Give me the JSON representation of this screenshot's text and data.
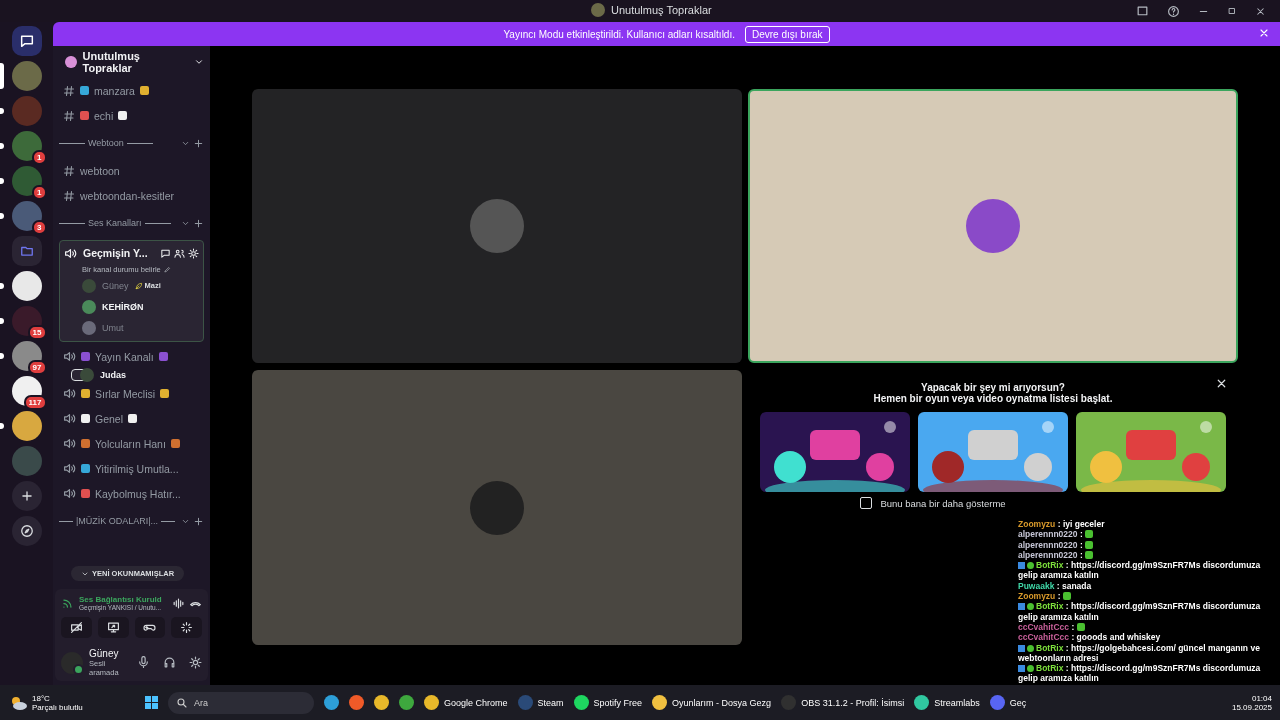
{
  "window": {
    "title": "Unutulmuş Topraklar"
  },
  "banner": {
    "text": "Yayıncı Modu etkinleştirildi. Kullanıcı adları kısaltıldı.",
    "button": "Devre dışı bırak"
  },
  "servers": [
    {
      "kind": "home"
    },
    {
      "kind": "server",
      "selected": true,
      "unread": false,
      "color": "#6b6a48"
    },
    {
      "kind": "server",
      "selected": false,
      "unread": true,
      "color": "#5a2a22"
    },
    {
      "kind": "server",
      "selected": false,
      "unread": true,
      "color": "#3d6a3a",
      "badge": "1"
    },
    {
      "kind": "server",
      "selected": false,
      "unread": true,
      "color": "#2f5a34",
      "badge": "1"
    },
    {
      "kind": "server",
      "selected": false,
      "unread": true,
      "color": "#4a5a78",
      "badge": "3"
    },
    {
      "kind": "folder"
    },
    {
      "kind": "server",
      "selected": false,
      "unread": true,
      "color": "#e8e8e8"
    },
    {
      "kind": "server",
      "selected": false,
      "unread": true,
      "color": "#3a1a2a",
      "badge": "15"
    },
    {
      "kind": "server",
      "selected": false,
      "unread": true,
      "color": "#8a8a8a",
      "badge": "97"
    },
    {
      "kind": "server",
      "selected": false,
      "unread": false,
      "color": "#f0f0f0",
      "badge": "117"
    },
    {
      "kind": "server",
      "selected": false,
      "unread": true,
      "color": "#d8a840"
    },
    {
      "kind": "server",
      "selected": false,
      "unread": false,
      "color": "#3a4a4a"
    },
    {
      "kind": "add"
    },
    {
      "kind": "discover"
    }
  ],
  "channel_header": "Unutulmuş Topraklar",
  "channels": [
    {
      "kind": "text",
      "name": "manzara",
      "emoji_before": true,
      "emoji_after": true
    },
    {
      "kind": "text",
      "name": "echi",
      "emoji_before": true,
      "emoji_after": true
    },
    {
      "kind": "category",
      "name": "Webtoon"
    },
    {
      "kind": "text",
      "name": "webtoon",
      "emoji_before": false,
      "emoji_after": false
    },
    {
      "kind": "text",
      "name": "webtoondan-kesitler",
      "emoji_before": false,
      "emoji_after": false
    },
    {
      "kind": "category",
      "name": "Ses Kanalları"
    },
    {
      "kind": "voice",
      "name": "Geçmişin Y...",
      "selected": true,
      "status": "Bir kanal durumu belirle",
      "members": [
        {
          "name": "Güney",
          "dimmed": true,
          "tag": "Mazi"
        },
        {
          "name": "KEHİRØN",
          "dimmed": false
        },
        {
          "name": "Umut",
          "dimmed": true
        }
      ]
    },
    {
      "kind": "voice",
      "name": "Yayın Kanalı",
      "selected": false,
      "emoji_before": true,
      "emoji_after": true,
      "members": [
        {
          "name": "Judas",
          "dimmed": false
        }
      ]
    },
    {
      "kind": "voice",
      "name": "Sırlar Meclisi",
      "selected": false,
      "emoji_before": true,
      "emoji_after": true
    },
    {
      "kind": "voice",
      "name": "Genel",
      "selected": false,
      "emoji_before": true,
      "emoji_after": true
    },
    {
      "kind": "voice",
      "name": "Yolcuların Hanı",
      "selected": false,
      "emoji_before": true,
      "emoji_after": true
    },
    {
      "kind": "voice",
      "name": "Yitirilmiş Umutla...",
      "selected": false,
      "emoji_before": true,
      "emoji_after": false
    },
    {
      "kind": "voice",
      "name": "Kaybolmuş Hatır...",
      "selected": false,
      "emoji_before": true,
      "emoji_after": false
    },
    {
      "kind": "category",
      "name": "|MÜZİK ODALARI|..."
    }
  ],
  "unread_pill": "YENİ OKUNMAMIŞLAR",
  "voice_panel": {
    "title": "Ses Bağlantısı Kuruld",
    "subtitle": "Geçmişin YANKISI / Unutu..."
  },
  "user": {
    "name": "Güney",
    "status": "Sesli aramada"
  },
  "tiles": [
    {
      "kind": "video",
      "speaking": false,
      "color": "#232325"
    },
    {
      "kind": "video",
      "speaking": true,
      "color": "#d6cab6"
    },
    {
      "kind": "video",
      "speaking": false,
      "color": "#4a4741"
    },
    {
      "kind": "activity",
      "title": "Yapacak bir şey mi arıyorsun?",
      "subtitle": "Hemen bir oyun veya video oynatma listesi başlat.",
      "checkbox": {
        "label": "Bunu bana bir daha gösterme",
        "checked": false
      }
    }
  ],
  "chat": [
    {
      "user": "Zoomyzu",
      "color": "#d99a2b",
      "bot": false,
      "kind": "text",
      "text": ": iyi geceler"
    },
    {
      "user": "alperennn0220",
      "color": "#c8c8d8",
      "bot": false,
      "kind": "emote",
      "text": ":"
    },
    {
      "user": "alperennn0220",
      "color": "#c8c8d8",
      "bot": false,
      "kind": "emote",
      "text": ":"
    },
    {
      "user": "alperennn0220",
      "color": "#c8c8d8",
      "bot": false,
      "kind": "emote",
      "text": ":"
    },
    {
      "user": "BotRix",
      "color": "#7ee03c",
      "bot": true,
      "kind": "text",
      "text": ": https://discord.gg/m9SznFR7Ms discordumuza gelip aramıza katılın"
    },
    {
      "user": "Puwaakk",
      "color": "#40d8a8",
      "bot": false,
      "kind": "text",
      "text": ": sanada"
    },
    {
      "user": "Zoomyzu",
      "color": "#d99a2b",
      "bot": false,
      "kind": "emote",
      "text": ":"
    },
    {
      "user": "BotRix",
      "color": "#7ee03c",
      "bot": true,
      "kind": "text",
      "text": ": https://discord.gg/m9SznFR7Ms discordumuza gelip aramıza katılın"
    },
    {
      "user": "ccCvahitCcc",
      "color": "#c8609a",
      "bot": false,
      "kind": "emote",
      "text": ":"
    },
    {
      "user": "ccCvahitCcc",
      "color": "#c8609a",
      "bot": false,
      "kind": "text",
      "text": ": gooods and whiskey"
    },
    {
      "user": "BotRix",
      "color": "#7ee03c",
      "bot": true,
      "kind": "text",
      "text": ": https://golgebahcesi.com/ güncel manganın ve webtoonların adresi"
    },
    {
      "user": "BotRix",
      "color": "#7ee03c",
      "bot": true,
      "kind": "text",
      "text": ": https://discord.gg/m9SznFR7Ms discordumuza gelip aramıza katılın"
    }
  ],
  "taskbar": {
    "temperature": "18°C",
    "weather": "Parçalı bulutlu",
    "search": {
      "placeholder": "Ara"
    },
    "pinned": [
      {
        "color": "#2d9fd8"
      },
      {
        "color": "#f05a28"
      },
      {
        "color": "#e8b82a"
      },
      {
        "color": "#3ea83e"
      }
    ],
    "apps": [
      {
        "label": "Google Chrome",
        "color": "#e8b82a"
      },
      {
        "label": "Steam",
        "color": "#2a4a78"
      },
      {
        "label": "Spotify Free",
        "color": "#1ed760"
      },
      {
        "label": "Oyunlarım - Dosya Gezg",
        "color": "#f0c040"
      },
      {
        "label": "OBS 31.1.2 - Profil: İsimsi",
        "color": "#303030"
      },
      {
        "label": "Streamlabs",
        "color": "#30c8a0"
      },
      {
        "label": "Geç",
        "color": "#5865f2"
      }
    ],
    "time": "01:04",
    "date": "15.09.2025"
  }
}
